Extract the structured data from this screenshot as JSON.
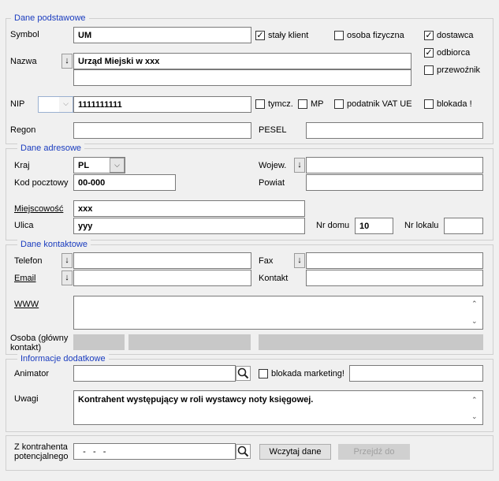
{
  "sections": {
    "basic": "Dane podstawowe",
    "address": "Dane adresowe",
    "contact": "Dane kontaktowe",
    "extra": "Informacje dodatkowe"
  },
  "basic": {
    "symbol_label": "Symbol",
    "symbol_value": "UM",
    "name_label": "Nazwa",
    "name_value": "Urząd Miejski w xxx",
    "name_value2": "",
    "nip_label": "NIP",
    "nip_value": "1111111111",
    "regon_label": "Regon",
    "regon_value": "",
    "pesel_label": "PESEL",
    "pesel_value": "",
    "checks": {
      "staly_klient": {
        "label": "stały klient",
        "checked": true
      },
      "osoba_fizyczna": {
        "label": "osoba fizyczna",
        "checked": false
      },
      "dostawca": {
        "label": "dostawca",
        "checked": true
      },
      "odbiorca": {
        "label": "odbiorca",
        "checked": true
      },
      "przewoznik": {
        "label": "przewoźnik",
        "checked": false
      },
      "tymcz": {
        "label": "tymcz.",
        "checked": false
      },
      "mp": {
        "label": "MP",
        "checked": false
      },
      "vat_ue": {
        "label": "podatnik VAT UE",
        "checked": false
      },
      "blokada": {
        "label": "blokada !",
        "checked": false
      }
    }
  },
  "address": {
    "kraj_label": "Kraj",
    "kraj_value": "PL",
    "kod_label": "Kod pocztowy",
    "kod_value": "00-000",
    "woj_label": "Wojew.",
    "woj_value": "",
    "powiat_label": "Powiat",
    "powiat_value": "",
    "miejsc_label": "Miejscowość",
    "miejsc_value": "xxx",
    "ulica_label": "Ulica",
    "ulica_value": "yyy",
    "nrdomu_label": "Nr domu",
    "nrdomu_value": "10",
    "nrlokalu_label": "Nr lokalu",
    "nrlokalu_value": ""
  },
  "contact": {
    "telefon_label": "Telefon",
    "telefon_value": "",
    "fax_label": "Fax",
    "fax_value": "",
    "email_label": "Email",
    "email_value": "",
    "kontakt_label": "Kontakt",
    "kontakt_value": "",
    "www_label": "WWW",
    "www_value": "",
    "osoba_label_1": "Osoba (główny",
    "osoba_label_2": "kontakt)"
  },
  "extra": {
    "animator_label": "Animator",
    "animator_value": "",
    "blokada_marketing": {
      "label": "blokada marketing!",
      "checked": false
    },
    "blokada_marketing_value": "",
    "uwagi_label": "Uwagi",
    "uwagi_value": "Kontrahent występujący w roli wystawcy noty księgowej."
  },
  "bottom": {
    "label_1": "Z kontrahenta",
    "label_2": "potencjalnego",
    "value": "  -   -   -",
    "load_button": "Wczytaj dane",
    "goto_button": "Przejdź do"
  },
  "icons": {
    "down_arrow": "↓",
    "check": "✓",
    "scroll_up": "⌃",
    "scroll_down": "⌄",
    "dropdown": "⌵"
  }
}
